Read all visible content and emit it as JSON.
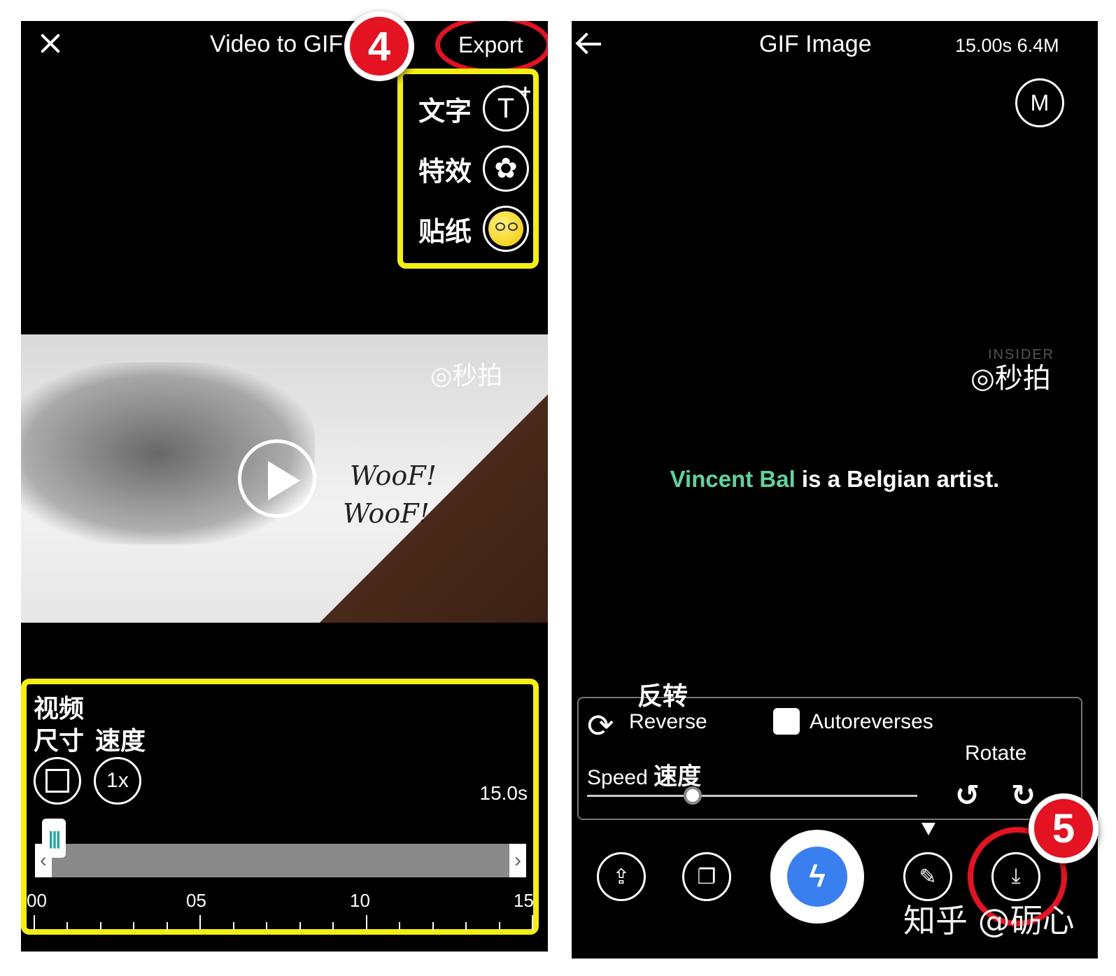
{
  "left_screen": {
    "title": "Video to GIF",
    "export_label": "Export",
    "step_badge": "4",
    "tools": [
      {
        "label": "文字",
        "icon": "text-add-icon",
        "glyph": "T",
        "plus": "+"
      },
      {
        "label": "特效",
        "icon": "effect-splash-icon",
        "glyph": "✿"
      },
      {
        "label": "贴纸",
        "icon": "sticker-emoji-icon",
        "glyph": ""
      }
    ],
    "video": {
      "watermark": "◎秒拍",
      "woof_1": "WooF!",
      "woof_2": "WooF!"
    },
    "bottom": {
      "label_video": "视频",
      "label_size": "尺寸",
      "label_speed": "速度",
      "speed_value": "1x",
      "duration": "15.0s",
      "playhead_glyph": "|||",
      "trim_left": "‹",
      "trim_right": "›",
      "ticks": [
        "00",
        "05",
        "10",
        "15"
      ]
    },
    "colors": {
      "highlight": "#f3ef10",
      "annotation_red": "#e41322"
    }
  },
  "right_screen": {
    "title": "GIF Image",
    "meta": "15.00s 6.4M",
    "m_badge": "M",
    "insider": "INSIDER",
    "watermark": "◎秒拍",
    "caption_accent": "Vincent Bal",
    "caption_rest": " is a Belgian artist.",
    "reverse_cn": "反转",
    "reverse_label": "Reverse",
    "autoreverses_label": "Autoreverses",
    "speed_label": "Speed",
    "speed_cn": "速度",
    "rotate_label": "Rotate",
    "speed_slider_fraction": 0.32,
    "step_badge": "5",
    "zhihu_watermark": "知乎 @砺心",
    "toolbar": [
      {
        "icon": "share-icon",
        "glyph": "⇪"
      },
      {
        "icon": "frames-icon",
        "glyph": "❐"
      },
      {
        "icon": "messenger-icon",
        "glyph": "ϟ"
      },
      {
        "icon": "edit-pencil-icon",
        "glyph": "✎"
      },
      {
        "icon": "download-icon",
        "glyph": "⤓"
      }
    ],
    "colors": {
      "accent_green": "#5fd49a",
      "messenger_blue": "#3a7ff0"
    }
  }
}
